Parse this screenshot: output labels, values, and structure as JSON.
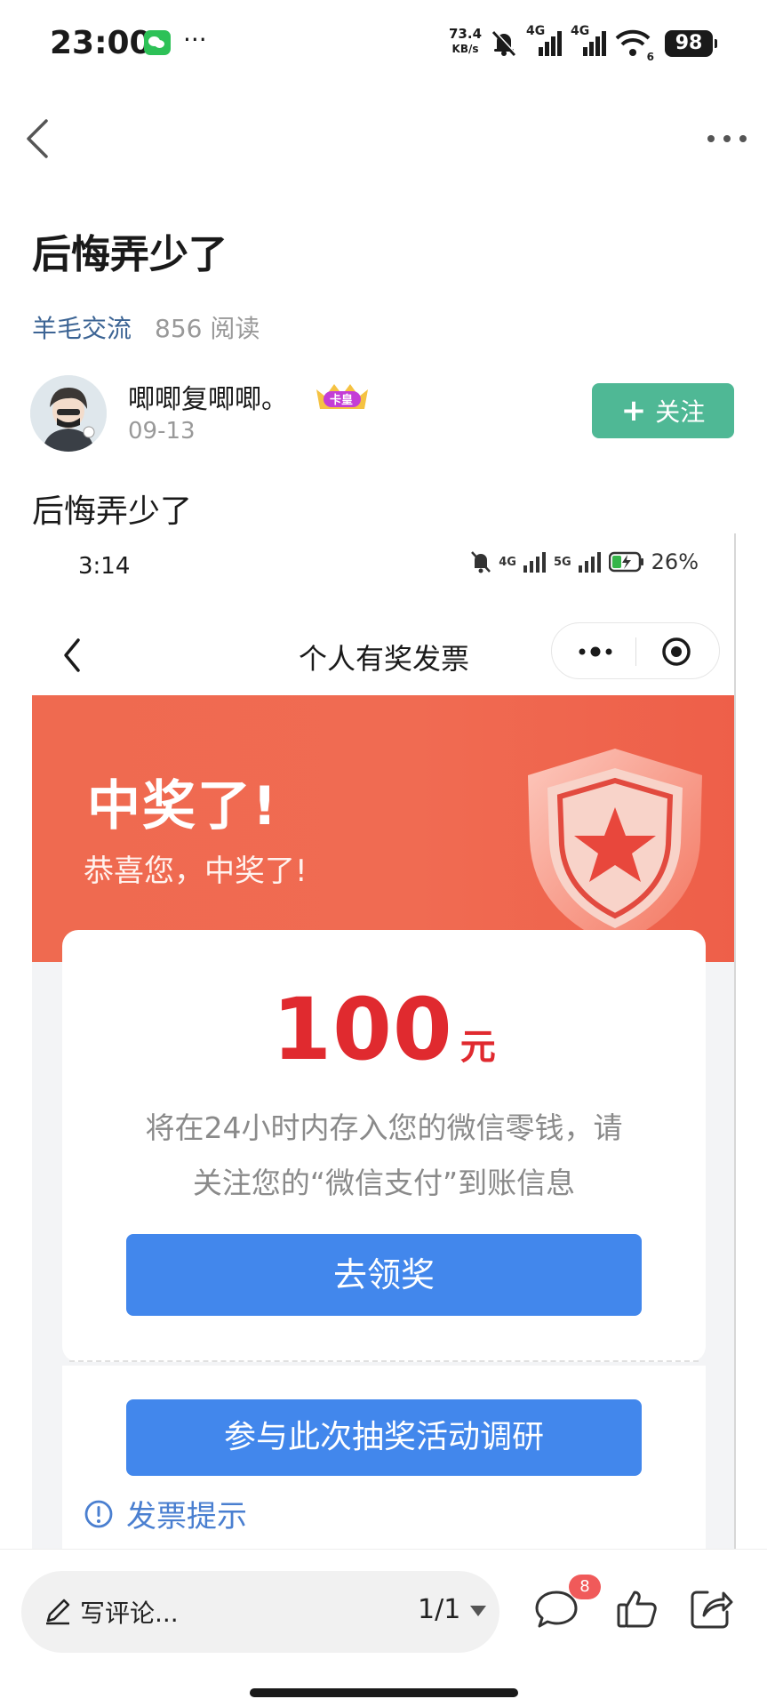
{
  "status_bar": {
    "time": "23:00",
    "more": "···",
    "net_speed_value": "73.4",
    "net_speed_unit": "KB/s",
    "signal1_label": "4G",
    "signal2_label": "4G",
    "wifi_label": "6",
    "battery": "98"
  },
  "post": {
    "title": "后悔弄少了",
    "category": "羊毛交流",
    "reads": "856 阅读",
    "author": {
      "name": "唧唧复唧唧。",
      "badge": "卡皇",
      "date": "09-13"
    },
    "follow_label": "关注",
    "body": "后悔弄少了"
  },
  "embedded_screenshot": {
    "time": "3:14",
    "signal1_label": "4G",
    "signal2_label": "5G",
    "battery": "26%",
    "page_title": "个人有奖发票",
    "banner_title": "中奖了!",
    "banner_subtitle": "恭喜您，中奖了!",
    "amount": "100",
    "amount_unit": "元",
    "desc_line1": "将在24小时内存入您的微信零钱，请",
    "desc_line2": "关注您的“微信支付”到账信息",
    "claim_button": "去领奖",
    "survey_button": "参与此次抽奖活动调研",
    "tip": "发票提示"
  },
  "bottom_bar": {
    "comment_placeholder": "写评论...",
    "page_indicator": "1/1",
    "comment_count": "8"
  },
  "colors": {
    "follow_button": "#4fb895",
    "category_link": "#3c6494",
    "prize_red": "#e02a2f",
    "banner_orange": "#ef6a50",
    "button_blue": "#4287ec",
    "badge_red": "#f05a5a"
  },
  "icons": {
    "nav_back": "chevron-left-icon",
    "nav_more": "more-horizontal-icon",
    "shield": "shield-star-icon",
    "tip": "info-circle-icon",
    "comment": "comment-bubble-icon",
    "like": "thumbs-up-icon",
    "share": "share-icon"
  }
}
